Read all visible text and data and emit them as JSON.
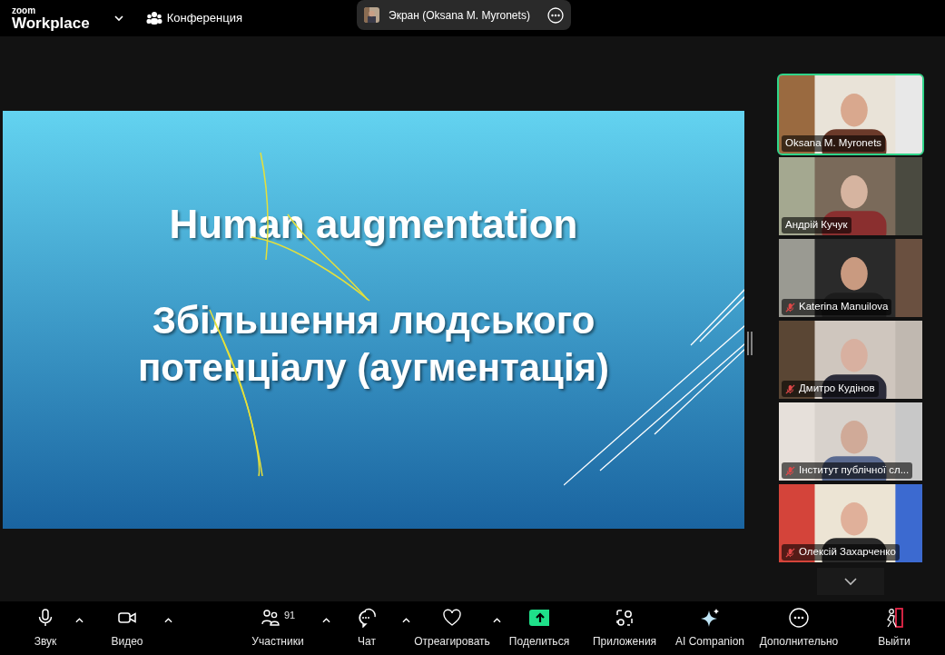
{
  "top_bar": {
    "brand_small": "zoom",
    "brand": "Workplace",
    "meeting_label": "Конференция",
    "share_pill": {
      "label": "Экран (Oksana M. Myronets)"
    }
  },
  "slide": {
    "title": "Human augmentation",
    "subtitle_lines": [
      "Збільшення людського",
      "потенціалу (аугментація)"
    ]
  },
  "participants": [
    {
      "name": "Oksana M. Myronets",
      "muted": false,
      "speaking": true
    },
    {
      "name": "Андрій Кучук",
      "muted": false,
      "speaking": false
    },
    {
      "name": "Katerina Manuilova",
      "muted": true,
      "speaking": false
    },
    {
      "name": "Дмитро Кудінов",
      "muted": true,
      "speaking": false
    },
    {
      "name": "Інститут публічної сл...",
      "muted": true,
      "speaking": false
    },
    {
      "name": "Олексій Захарченко",
      "muted": true,
      "speaking": false
    }
  ],
  "toolbar": [
    {
      "label": "Звук",
      "kind": "mic",
      "has_menu": true
    },
    {
      "label": "Видео",
      "kind": "video",
      "has_menu": true
    },
    {
      "label": "Участники",
      "kind": "people",
      "has_menu": true,
      "count": "91"
    },
    {
      "label": "Чат",
      "kind": "chat",
      "has_menu": true
    },
    {
      "label": "Отреагировать",
      "kind": "heart",
      "has_menu": true
    },
    {
      "label": "Поделиться",
      "kind": "share",
      "has_menu": false
    },
    {
      "label": "Приложения",
      "kind": "apps",
      "has_menu": false
    },
    {
      "label": "AI Companion",
      "kind": "sparkle",
      "has_menu": false
    },
    {
      "label": "Дополнительно",
      "kind": "more",
      "has_menu": false
    },
    {
      "label": "Выйти",
      "kind": "leave",
      "has_menu": false
    }
  ]
}
